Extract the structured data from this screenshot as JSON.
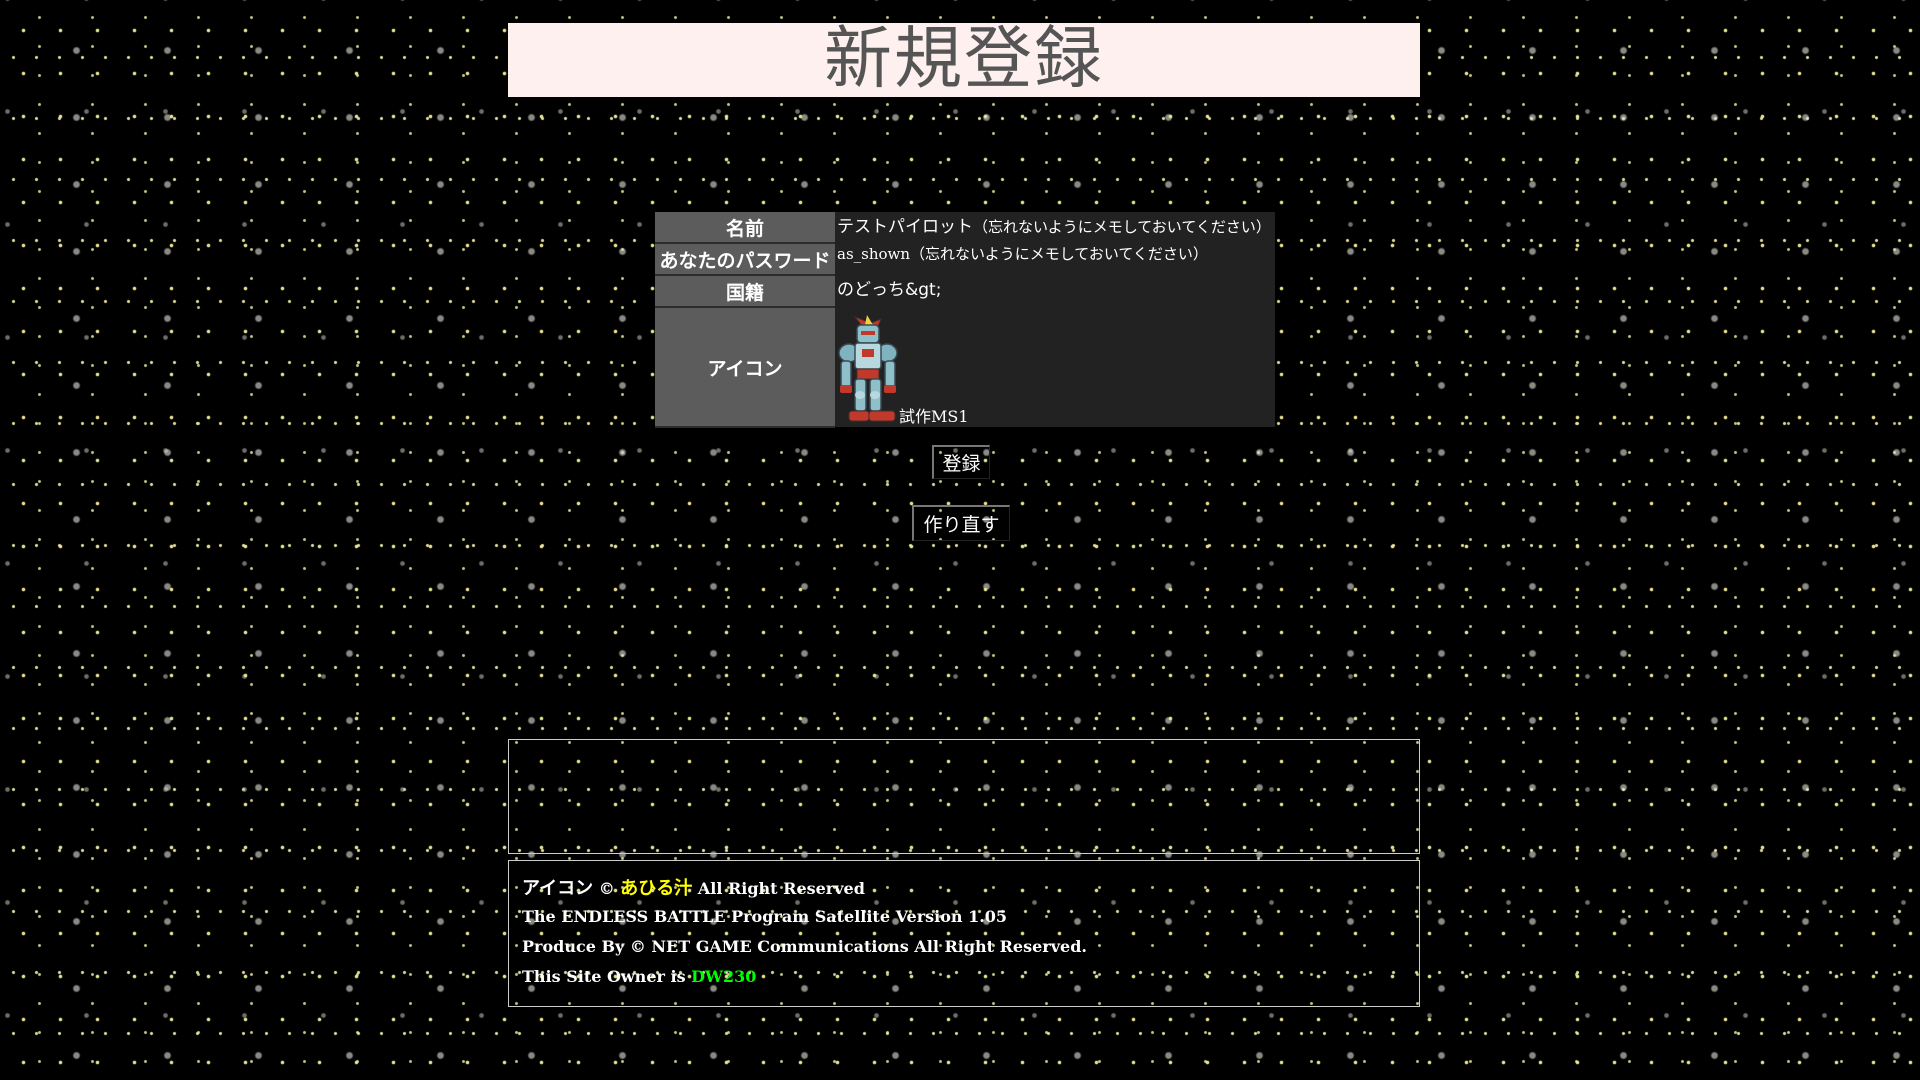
{
  "header": {
    "title": "新規登録"
  },
  "form_table": {
    "name": {
      "label": "名前",
      "value": "テストパイロット",
      "note": "（忘れないようにメモしておいてください）"
    },
    "password": {
      "label": "あなたのパスワード",
      "value": "as_shown",
      "note": "（忘れないようにメモしておいてください）"
    },
    "nationality": {
      "label": "国籍",
      "value": "のどっち&gt;"
    },
    "icon": {
      "label": "アイコン",
      "icon_name": "robot-mecha-icon",
      "caption": "試作MS1"
    }
  },
  "buttons": {
    "register": "登録",
    "reset": "作り直す"
  },
  "footer": {
    "icon_credit_label": "アイコン",
    "copyright_symbol": "©",
    "icon_author": "あひる汁",
    "icon_rights": "All Right Reserved",
    "program_line": "The ENDLESS BATTLE Program Satellite Version 1.05",
    "produce_line": "Produce By © NET GAME Communications All Right Reserved.",
    "owner_prefix": "This Site Owner is",
    "owner_name": "DW230"
  },
  "colors": {
    "background": "#000000",
    "title_bg": "#fff0f0",
    "title_text": "#555555",
    "label_cell": "#5c5c5c",
    "value_cell": "#222222",
    "icon_author": "#ffff00",
    "owner_name": "#00ff00"
  }
}
